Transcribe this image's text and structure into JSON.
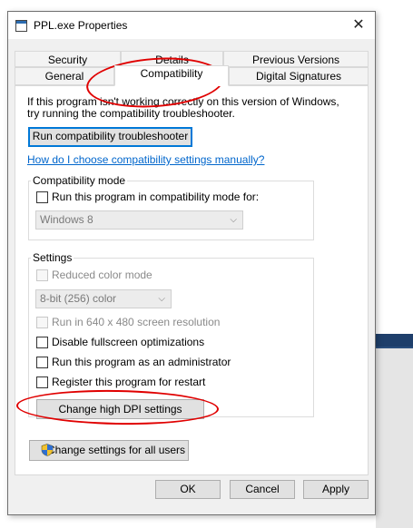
{
  "window": {
    "title": "PPL.exe Properties",
    "close_glyph": "✕",
    "icon": "app-icon"
  },
  "tabs_row1": [
    {
      "label": "Security"
    },
    {
      "label": "Details"
    },
    {
      "label": "Previous Versions"
    }
  ],
  "tabs_row2": [
    {
      "label": "General"
    },
    {
      "label": "Compatibility",
      "active": true
    },
    {
      "label": "Digital Signatures"
    }
  ],
  "panel": {
    "intro_line1": "If this program isn't working correctly on this version of Windows,",
    "intro_line2": "try running the compatibility troubleshooter.",
    "troubleshooter_button": "Run compatibility troubleshooter",
    "manual_link": "How do I choose compatibility settings manually?",
    "compat_mode": {
      "legend": "Compatibility mode",
      "checkbox_label": "Run this program in compatibility mode for:",
      "checked": false,
      "select_value": "Windows 8"
    },
    "settings": {
      "legend": "Settings",
      "reduced_color": "Reduced color mode",
      "color_select": "8-bit (256) color",
      "res640": "Run in 640 x 480 screen resolution",
      "fullscreen": "Disable fullscreen optimizations",
      "admin": "Run this program as an administrator",
      "register": "Register this program for restart",
      "dpi_button": "Change high DPI settings"
    },
    "all_users_button": "Change settings for all users"
  },
  "footer": {
    "ok": "OK",
    "cancel": "Cancel",
    "apply": "Apply"
  },
  "annotation_color": "#e00000"
}
